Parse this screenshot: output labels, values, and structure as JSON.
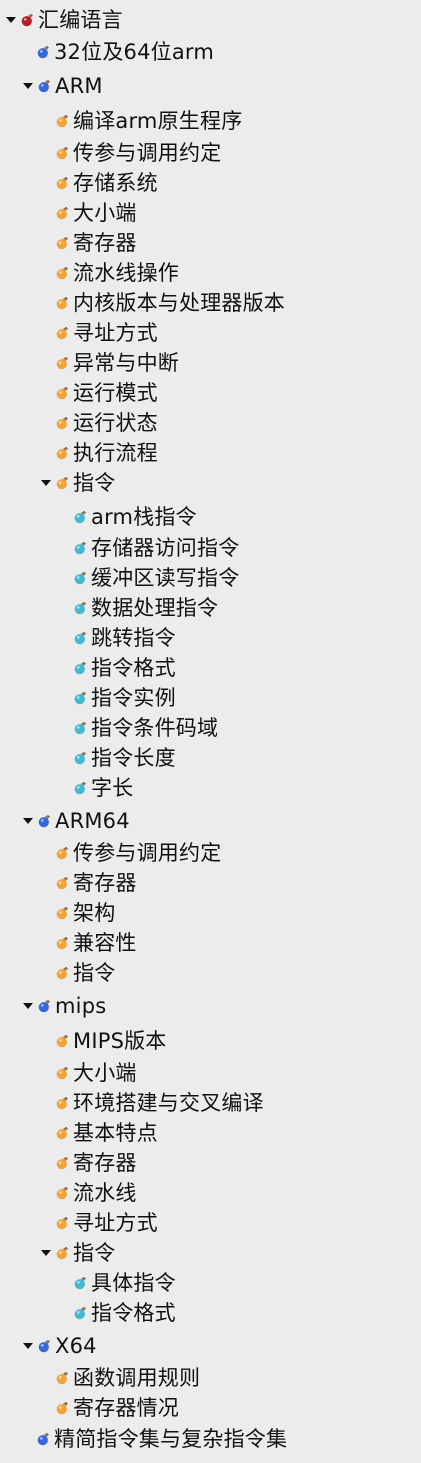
{
  "colors": {
    "background": "#ececec",
    "root_icon": "#b11d2a",
    "section_icon": "#3768d9",
    "topic_icon": "#f0a43a",
    "leaf_icon": "#45b8d2",
    "text": "#111111"
  },
  "icons": {
    "root": "red-bomb-icon",
    "section": "blue-bomb-icon",
    "topic": "orange-bomb-icon",
    "leaf": "cyan-bomb-icon"
  },
  "tree": {
    "root": {
      "label": "汇编语言"
    },
    "items": [
      {
        "label": "32位及64位arm"
      },
      {
        "label": "ARM"
      },
      {
        "label": "编译arm原生程序"
      },
      {
        "label": "传参与调用约定"
      },
      {
        "label": "存储系统"
      },
      {
        "label": "大小端"
      },
      {
        "label": "寄存器"
      },
      {
        "label": "流水线操作"
      },
      {
        "label": "内核版本与处理器版本"
      },
      {
        "label": "寻址方式"
      },
      {
        "label": "异常与中断"
      },
      {
        "label": "运行模式"
      },
      {
        "label": "运行状态"
      },
      {
        "label": "执行流程"
      },
      {
        "label": "指令"
      },
      {
        "label": "arm栈指令"
      },
      {
        "label": "存储器访问指令"
      },
      {
        "label": "缓冲区读写指令"
      },
      {
        "label": "数据处理指令"
      },
      {
        "label": "跳转指令"
      },
      {
        "label": "指令格式"
      },
      {
        "label": "指令实例"
      },
      {
        "label": "指令条件码域"
      },
      {
        "label": "指令长度"
      },
      {
        "label": "字长"
      },
      {
        "label": "ARM64"
      },
      {
        "label": "传参与调用约定"
      },
      {
        "label": "寄存器"
      },
      {
        "label": "架构"
      },
      {
        "label": "兼容性"
      },
      {
        "label": "指令"
      },
      {
        "label": "mips"
      },
      {
        "label": "MIPS版本"
      },
      {
        "label": "大小端"
      },
      {
        "label": "环境搭建与交叉编译"
      },
      {
        "label": "基本特点"
      },
      {
        "label": "寄存器"
      },
      {
        "label": "流水线"
      },
      {
        "label": "寻址方式"
      },
      {
        "label": "指令"
      },
      {
        "label": "具体指令"
      },
      {
        "label": "指令格式"
      },
      {
        "label": "X64"
      },
      {
        "label": "函数调用规则"
      },
      {
        "label": "寄存器情况"
      },
      {
        "label": "精简指令集与复杂指令集"
      }
    ]
  }
}
